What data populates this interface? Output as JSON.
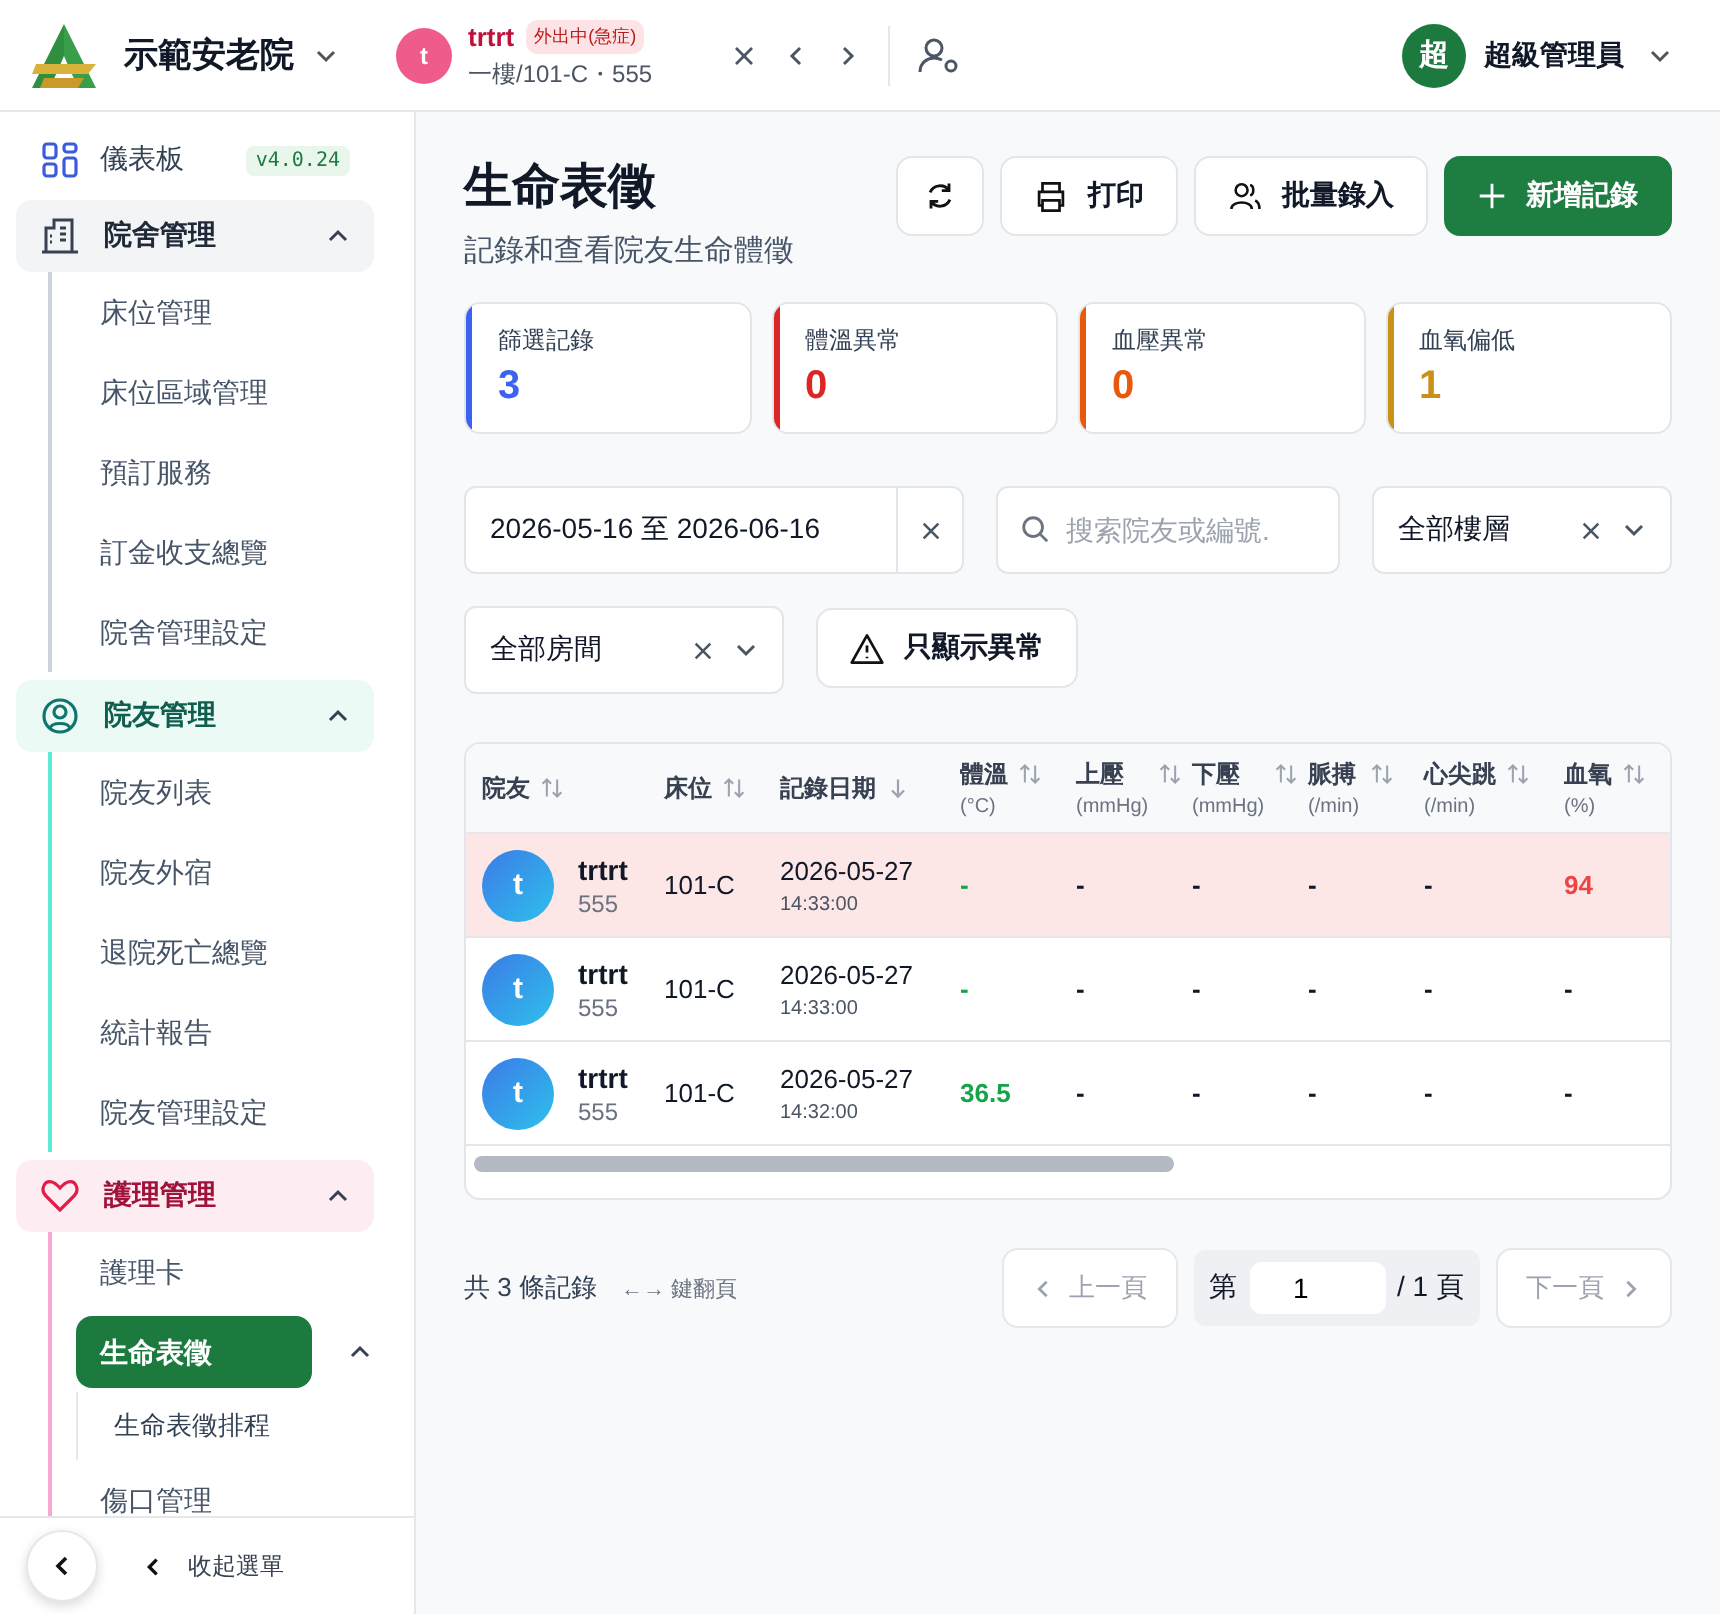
{
  "header": {
    "org": "示範安老院",
    "resident": {
      "avatar": "t",
      "name": "trtrt",
      "badge": "外出中(急症)",
      "location": "一樓/101-C・555"
    },
    "user": {
      "avatar": "超",
      "name": "超級管理員"
    }
  },
  "sidebar": {
    "dashboard": {
      "label": "儀表板",
      "version": "v4.0.24"
    },
    "groups": [
      {
        "label": "院舍管理",
        "expanded": true,
        "items": [
          {
            "label": "床位管理",
            "selected": false
          },
          {
            "label": "床位區域管理",
            "selected": false
          },
          {
            "label": "預訂服務",
            "selected": false
          },
          {
            "label": "訂金收支總覽",
            "selected": false
          },
          {
            "label": "院舍管理設定",
            "selected": false
          }
        ]
      },
      {
        "label": "院友管理",
        "expanded": true,
        "items": [
          {
            "label": "院友列表",
            "selected": false
          },
          {
            "label": "院友外宿",
            "selected": false
          },
          {
            "label": "退院死亡總覽",
            "selected": false
          },
          {
            "label": "統計報告",
            "selected": false
          },
          {
            "label": "院友管理設定",
            "selected": false
          }
        ]
      },
      {
        "label": "護理管理",
        "expanded": true,
        "items": [
          {
            "label": "護理卡",
            "selected": false
          },
          {
            "label": "生命表徵",
            "selected": true,
            "expanded": true,
            "children": [
              {
                "label": "生命表徵排程",
                "selected": false
              }
            ]
          },
          {
            "label": "傷口管理",
            "selected": false
          }
        ]
      }
    ],
    "collapse": "收起選單"
  },
  "page": {
    "title": "生命表徵",
    "subtitle": "記錄和查看院友生命體徵",
    "buttons": [
      {
        "kind": "refresh"
      },
      {
        "kind": "print",
        "label": "打印"
      },
      {
        "kind": "batch",
        "label": "批量錄入"
      },
      {
        "kind": "add",
        "label": "新增記錄"
      }
    ]
  },
  "stats": [
    {
      "label": "篩選記錄",
      "value": "3",
      "color": "#3b63f0"
    },
    {
      "label": "體溫異常",
      "value": "0",
      "color": "#dc2626"
    },
    {
      "label": "血壓異常",
      "value": "0",
      "color": "#ea580c"
    },
    {
      "label": "血氧偏低",
      "value": "1",
      "color": "#c9901a"
    }
  ],
  "filters": {
    "date_range": "2026-05-16 至 2026-06-16",
    "search": {
      "placeholder": "搜索院友或編號."
    },
    "floor": "全部樓層",
    "room": "全部房間",
    "abnormal_only": {
      "label": "只顯示異常",
      "on": false
    }
  },
  "table": {
    "columns": [
      {
        "label": "院友",
        "sorted": false
      },
      {
        "label": "床位",
        "sorted": false
      },
      {
        "label": "記錄日期",
        "sorted": true
      },
      {
        "label": "體溫",
        "unit": "(°C)",
        "sorted": false
      },
      {
        "label": "上壓",
        "unit": "(mmHg)",
        "sorted": false
      },
      {
        "label": "下壓",
        "unit": "(mmHg)",
        "sorted": false
      },
      {
        "label": "脈搏",
        "unit": "(/min)",
        "sorted": false
      },
      {
        "label": "心尖跳",
        "unit": "(/min)",
        "sorted": false
      },
      {
        "label": "血氧",
        "unit": "(%)",
        "sorted": false
      }
    ],
    "rows": [
      {
        "avatar": "t",
        "name": "trtrt",
        "number": "555",
        "bed": "101-C",
        "date": "2026-05-27",
        "time": "14:33:00",
        "abnormal": true,
        "values": [
          {
            "text": "-",
            "color": "#16a34a"
          },
          {
            "text": "-",
            "color": "#111827"
          },
          {
            "text": "-",
            "color": "#111827"
          },
          {
            "text": "-",
            "color": "#111827"
          },
          {
            "text": "-",
            "color": "#111827"
          },
          {
            "text": "94",
            "color": "#ef4444"
          }
        ]
      },
      {
        "avatar": "t",
        "name": "trtrt",
        "number": "555",
        "bed": "101-C",
        "date": "2026-05-27",
        "time": "14:33:00",
        "abnormal": false,
        "values": [
          {
            "text": "-",
            "color": "#16a34a"
          },
          {
            "text": "-",
            "color": "#111827"
          },
          {
            "text": "-",
            "color": "#111827"
          },
          {
            "text": "-",
            "color": "#111827"
          },
          {
            "text": "-",
            "color": "#111827"
          },
          {
            "text": "-",
            "color": "#111827"
          }
        ]
      },
      {
        "avatar": "t",
        "name": "trtrt",
        "number": "555",
        "bed": "101-C",
        "date": "2026-05-27",
        "time": "14:32:00",
        "abnormal": false,
        "values": [
          {
            "text": "36.5",
            "color": "#16a34a"
          },
          {
            "text": "-",
            "color": "#111827"
          },
          {
            "text": "-",
            "color": "#111827"
          },
          {
            "text": "-",
            "color": "#111827"
          },
          {
            "text": "-",
            "color": "#111827"
          },
          {
            "text": "-",
            "color": "#111827"
          }
        ]
      }
    ]
  },
  "pagination": {
    "total": "共 3 條記錄",
    "hint": "←→ 鍵翻頁",
    "prev": "上一頁",
    "prev_disabled": true,
    "page_prefix": "第",
    "page": "1",
    "page_suffix": "/ 1 頁",
    "next": "下一頁",
    "next_disabled": true
  }
}
